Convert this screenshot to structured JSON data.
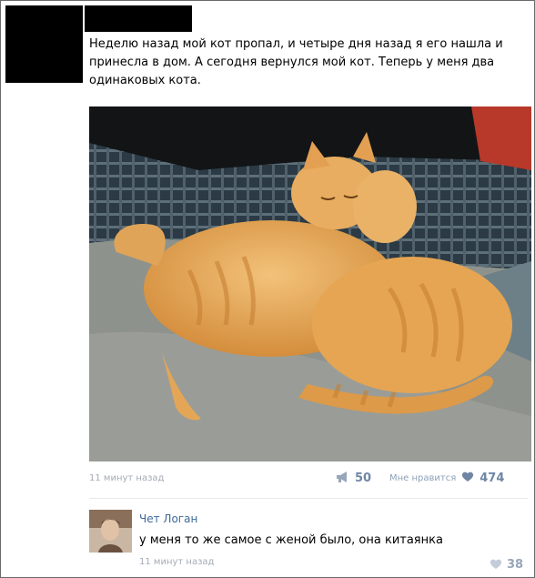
{
  "post": {
    "text": "Неделю назад мой кот пропал, и четыре дня назад я его нашла и принесла в дом. А сегодня вернулся мой кот. Теперь у меня два одинаковых кота.",
    "time": "11 минут назад",
    "share_count": "50",
    "like_label": "Мне нравится",
    "like_count": "474"
  },
  "comment": {
    "author": "Чет Логан",
    "text": "у меня то же самое с женой было, она китаянка",
    "time": "11 минут назад",
    "like_count": "38"
  },
  "icons": {
    "share": "megaphone-icon",
    "like": "heart-icon"
  },
  "colors": {
    "link": "#3d6a9a",
    "meta": "#a4abb5",
    "accent": "#6f86a5"
  }
}
